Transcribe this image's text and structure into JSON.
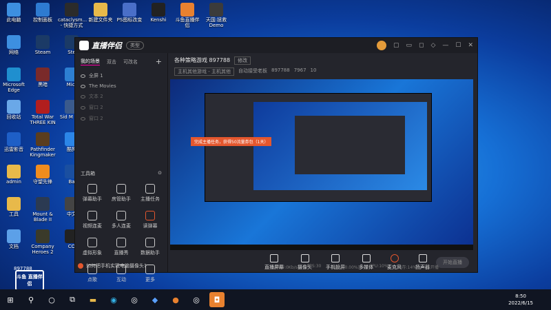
{
  "desktop": {
    "icons": [
      {
        "label": "此电脑",
        "icon": "computer-icon",
        "color": "#3d8fe0",
        "col": 0,
        "row": 0
      },
      {
        "label": "控制面板",
        "icon": "control-panel-icon",
        "color": "#2e7bd1",
        "col": 1,
        "row": 0
      },
      {
        "label": "cataclysm... - 快捷方式",
        "icon": "cataclysm-icon",
        "color": "#2b2b2b",
        "col": 2,
        "row": 0
      },
      {
        "label": "新建文件夹",
        "icon": "folder-icon",
        "color": "#e8b94a",
        "col": 3,
        "row": 0
      },
      {
        "label": "PS图标改变",
        "icon": "ps-icon",
        "color": "#4a6fc8",
        "col": 4,
        "row": 0
      },
      {
        "label": "Kenshi",
        "icon": "kenshi-icon",
        "color": "#222222",
        "col": 5,
        "row": 0
      },
      {
        "label": "斗鱼直播伴侣",
        "icon": "douyu-icon",
        "color": "#e8812f",
        "col": 6,
        "row": 0
      },
      {
        "label": "天国:拯救 Demo",
        "icon": "kcd-icon",
        "color": "#3b3b3b",
        "col": 7,
        "row": 0
      },
      {
        "label": "网络",
        "icon": "network-icon",
        "color": "#3d8fe0",
        "col": 0,
        "row": 1
      },
      {
        "label": "Steam",
        "icon": "steam-icon",
        "color": "#1b3a66",
        "col": 1,
        "row": 1
      },
      {
        "label": "Ste",
        "icon": "steam-icon",
        "color": "#1b3a66",
        "col": 2,
        "row": 1
      },
      {
        "label": "Microsoft Edge",
        "icon": "edge-icon",
        "color": "#1f8fcf",
        "col": 0,
        "row": 2
      },
      {
        "label": "黑暗",
        "icon": "game-icon",
        "color": "#7a2a2a",
        "col": 1,
        "row": 2
      },
      {
        "label": "Micr",
        "icon": "app-icon",
        "color": "#2d7fd2",
        "col": 2,
        "row": 2
      },
      {
        "label": "回收站",
        "icon": "recycle-bin-icon",
        "color": "#6aa8e8",
        "col": 0,
        "row": 3
      },
      {
        "label": "Total War THREE KIN",
        "icon": "totalwar-icon",
        "color": "#b11e1e",
        "col": 1,
        "row": 3
      },
      {
        "label": "Sid M Civi",
        "icon": "civ-icon",
        "color": "#3a5a8c",
        "col": 2,
        "row": 3
      },
      {
        "label": "迅雷影音",
        "icon": "player-icon",
        "color": "#1e5fc7",
        "col": 0,
        "row": 4
      },
      {
        "label": "Pathfinder Kingmaker",
        "icon": "pathfinder-icon",
        "color": "#5a3d1e",
        "col": 1,
        "row": 4
      },
      {
        "label": "酷狗",
        "icon": "kugou-icon",
        "color": "#2c86e8",
        "col": 2,
        "row": 4
      },
      {
        "label": "admin",
        "icon": "user-folder-icon",
        "color": "#e8b94a",
        "col": 0,
        "row": 5
      },
      {
        "label": "守望先锋",
        "icon": "overwatch-icon",
        "color": "#f08c1e",
        "col": 1,
        "row": 5
      },
      {
        "label": "Ba",
        "icon": "app-icon",
        "color": "#1a4fa0",
        "col": 2,
        "row": 5
      },
      {
        "label": "工具",
        "icon": "folder-icon",
        "color": "#e8b94a",
        "col": 0,
        "row": 6
      },
      {
        "label": "Mount & Blade II",
        "icon": "bannerlord-icon",
        "color": "#2b3a52",
        "col": 1,
        "row": 6
      },
      {
        "label": "中文",
        "icon": "app-icon",
        "color": "#444444",
        "col": 2,
        "row": 6
      },
      {
        "label": "文档",
        "icon": "document-icon",
        "color": "#5ca0e8",
        "col": 0,
        "row": 7
      },
      {
        "label": "Company Heroes 2",
        "icon": "coh-icon",
        "color": "#3a3a2a",
        "col": 1,
        "row": 7
      },
      {
        "label": "CO",
        "icon": "app-icon",
        "color": "#222222",
        "col": 2,
        "row": 7
      }
    ]
  },
  "app": {
    "logo_text": "直播伴侣",
    "type_button": "类型",
    "titlebar_icons": [
      "avatar-icon",
      "gift-icon",
      "screen-icon",
      "notice-icon",
      "skin-icon",
      "minimize-icon",
      "maximize-icon",
      "close-icon"
    ],
    "tabs": [
      "我的场景",
      "双击",
      "可改名"
    ],
    "add_tab": "+",
    "scenes": [
      {
        "label": "全屏 1",
        "active": true
      },
      {
        "label": "The Movies",
        "active": true
      },
      {
        "label": "文本 2",
        "active": false
      },
      {
        "label": "窗口 2",
        "active": false
      },
      {
        "label": "窗口 2",
        "active": false
      }
    ],
    "tools_title": "工具箱",
    "tools": [
      {
        "label": "弹幕助手"
      },
      {
        "label": "房管助手"
      },
      {
        "label": "主播任务"
      },
      {
        "label": "视频连麦"
      },
      {
        "label": "多人连麦"
      },
      {
        "label": "读弹幕"
      },
      {
        "label": "虚拟形象"
      },
      {
        "label": "直播秀"
      },
      {
        "label": "数据助手"
      },
      {
        "label": "点歌"
      },
      {
        "label": "互动"
      },
      {
        "label": "更多"
      }
    ],
    "bottom_tip": "如何把手机实现电脑摄像头?",
    "room_title": "各种策略游戏 897788",
    "modify_btn": "修改",
    "category": "主机其他游戏 - 主机其他",
    "auto_accept": "自动接受老板",
    "room_id": "897788",
    "hot": "7967",
    "fans": "10",
    "main_icons": [
      "layout-icon",
      "lock-icon",
      "share-icon",
      "bell-icon",
      "screen-icon",
      "sound-icon"
    ],
    "preview_banner": "完成主播任务，获得50流量券包（1天）",
    "controls": [
      "直播屏幕",
      "摄像头",
      "手机投屏",
      "多媒体",
      "麦克风",
      "扬声器"
    ],
    "start_button": "开始直播",
    "status": [
      "码率:0Kb/s",
      "FPS:30",
      "丢帧:0(0.00%)",
      "CPU:10%",
      "内存:14%",
      "未开播"
    ]
  },
  "taskbar": {
    "items": [
      "windows-icon",
      "search-icon",
      "cortana-icon",
      "task-view-icon",
      "explorer-icon",
      "edge-icon",
      "steam-icon",
      "feishu-icon",
      "douyu-icon",
      "steam-icon",
      "douyu-icon"
    ],
    "time": "8:50",
    "date": "2022/6/15"
  },
  "watermark": "斗鱼 直播伴侣",
  "stream_id": "897788"
}
